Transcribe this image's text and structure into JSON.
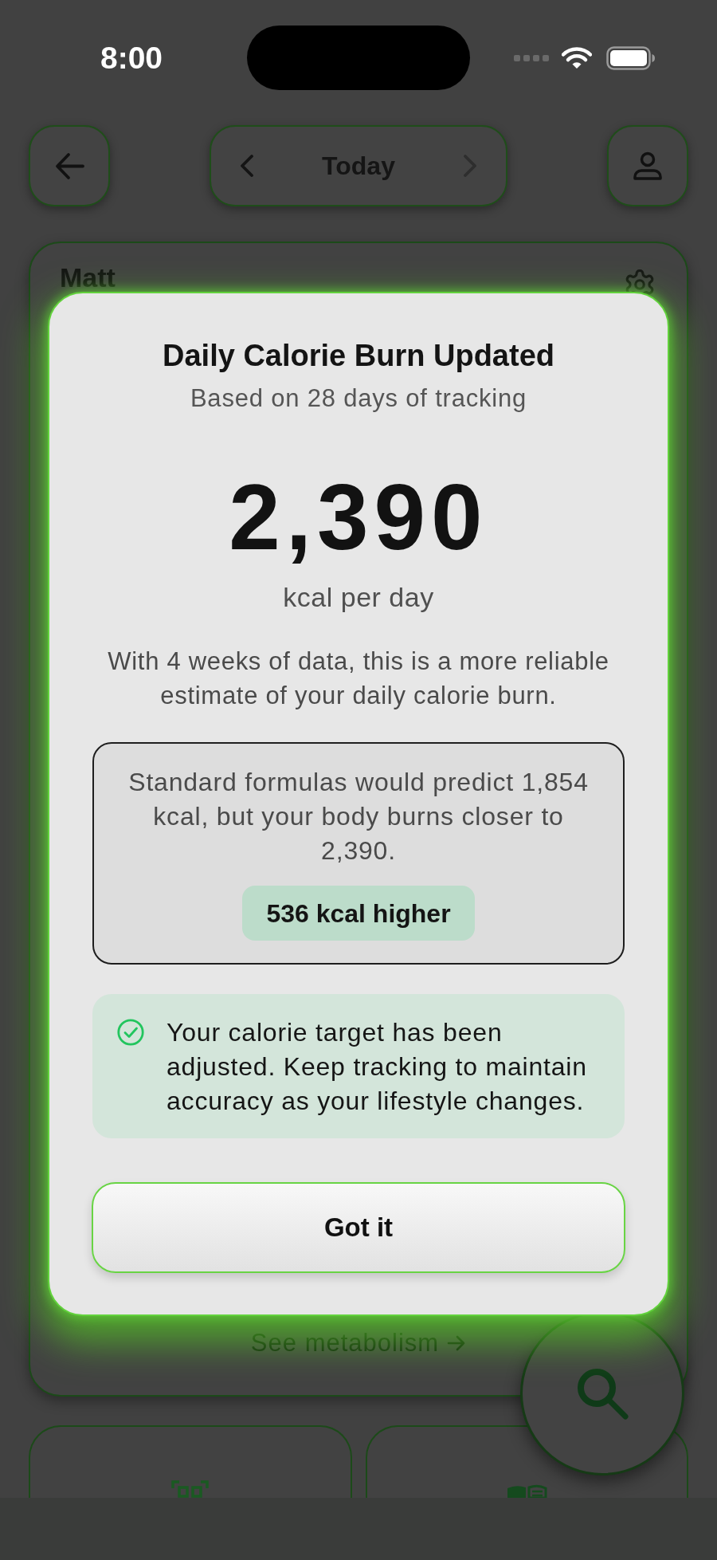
{
  "status_bar": {
    "time": "8:00"
  },
  "header": {
    "date_nav": {
      "label": "Today",
      "prev": {
        "disabled": false
      },
      "next": {
        "disabled": true
      }
    }
  },
  "summary_card": {
    "name": "Matt",
    "link": "See metabolism"
  },
  "dialog": {
    "title": "Daily Calorie Burn Updated",
    "subtitle": "Based on 28 days of tracking",
    "value": "2,390",
    "unit": "kcal per day",
    "description": "With 4 weeks of data, this is a more reliable estimate of your daily calorie burn.",
    "comparison": {
      "text": "Standard formulas would predict 1,854 kcal, but your body burns closer to 2,390.",
      "badge": "536 kcal higher"
    },
    "notice": {
      "text": "Your calorie target has been adjusted. Keep tracking to maintain accuracy as your lifestyle changes."
    },
    "button": "Got it"
  }
}
